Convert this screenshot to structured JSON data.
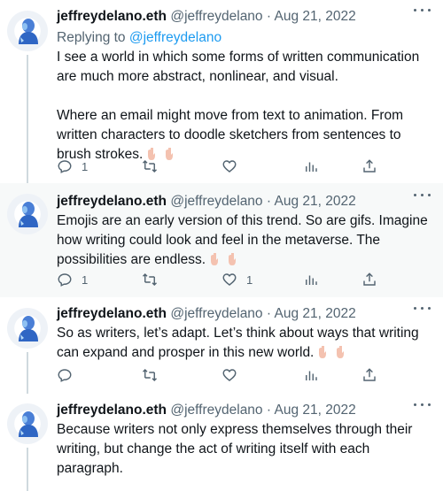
{
  "tweets": [
    {
      "name": "jeffreydelano.eth",
      "handle": "@jeffreydelano",
      "separator": "·",
      "date": "Aug 21, 2022",
      "replying_label": "Replying to",
      "replying_handle": "@jeffreydelano",
      "paragraphs": [
        "I see a world in which some forms of written communication are much more abstract, nonlinear, and visual.",
        "Where an email might move from text to animation. From written characters to doodle sketchers from sentences to brush strokes."
      ],
      "reply_count": "1",
      "retweet_count": "",
      "like_count": ""
    },
    {
      "name": "jeffreydelano.eth",
      "handle": "@jeffreydelano",
      "separator": "·",
      "date": "Aug 21, 2022",
      "paragraphs": [
        "Emojis are an early version of this trend. So are gifs. Imagine how writing could look and feel in the metaverse. The possibilities are endless."
      ],
      "reply_count": "1",
      "retweet_count": "",
      "like_count": "1"
    },
    {
      "name": "jeffreydelano.eth",
      "handle": "@jeffreydelano",
      "separator": "·",
      "date": "Aug 21, 2022",
      "paragraphs": [
        "So as writers, let’s adapt. Let’s think about ways that writing can expand and prosper in this new world."
      ],
      "reply_count": "",
      "retweet_count": "",
      "like_count": ""
    },
    {
      "name": "jeffreydelano.eth",
      "handle": "@jeffreydelano",
      "separator": "·",
      "date": "Aug 21, 2022",
      "paragraphs": [
        "Because writers not only express themselves through their writing, but change the act of writing itself with each paragraph."
      ]
    }
  ],
  "icons": {
    "reply": "reply-icon",
    "retweet": "retweet-icon",
    "like": "heart-icon",
    "views": "analytics-icon",
    "share": "share-icon",
    "more": "more-icon",
    "emoji": "point-down-emoji"
  },
  "colors": {
    "text": "#0f1419",
    "muted": "#536471",
    "link": "#1d9bf0",
    "highlight_bg": "#f7f9f9",
    "thread_line": "#cfd9de"
  }
}
